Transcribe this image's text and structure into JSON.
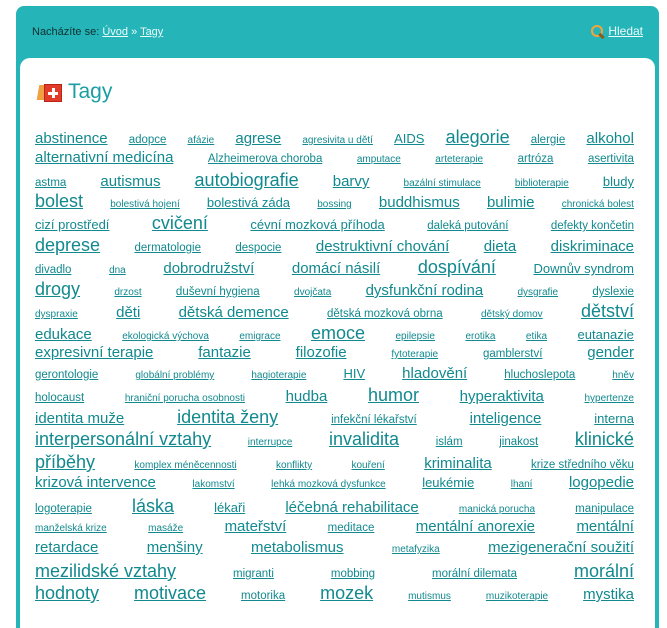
{
  "breadcrumb": {
    "prefix": "Nacházíte se:",
    "home": "Úvod",
    "separator": "»",
    "current": "Tagy"
  },
  "search": {
    "label": "Hledat",
    "icon": "magnifier-icon"
  },
  "page": {
    "title": "Tagy",
    "icon": "tag-icon"
  },
  "colors": {
    "frame": "#25b5b8",
    "link": "#12898e",
    "title": "#1a9ea3"
  },
  "lines": [
    [
      [
        "abstinence",
        4
      ],
      [
        "adopce",
        2
      ],
      [
        "afázie",
        1
      ],
      [
        "agrese",
        4
      ],
      [
        "agresivita u dětí",
        1
      ],
      [
        "AIDS",
        3
      ],
      [
        "alegorie",
        5
      ],
      [
        "alergie",
        2
      ],
      [
        "alkohol",
        4
      ]
    ],
    [
      [
        "alternativní medicína",
        4
      ],
      [
        "Alzheimerova choroba",
        2
      ],
      [
        "amputace",
        1
      ],
      [
        "arteterapie",
        1
      ],
      [
        "artróza",
        2
      ],
      [
        "asertivita",
        2
      ]
    ],
    [
      [
        "astma",
        2
      ],
      [
        "autismus",
        4
      ],
      [
        "autobiografie",
        5
      ],
      [
        "barvy",
        4
      ],
      [
        "bazální stimulace",
        1
      ],
      [
        "biblioterapie",
        1
      ],
      [
        "bludy",
        3
      ]
    ],
    [
      [
        "bolest",
        5
      ],
      [
        "bolestivá hojení",
        1
      ],
      [
        "bolestivá záda",
        3
      ],
      [
        "bossing",
        1
      ],
      [
        "buddhismus",
        4
      ],
      [
        "bulimie",
        4
      ],
      [
        "chronická bolest",
        1
      ]
    ],
    [
      [
        "cizí prostředí",
        3
      ],
      [
        "cvičení",
        5
      ],
      [
        "cévní mozková příhoda",
        3
      ],
      [
        "daleká putování",
        2
      ],
      [
        "defekty končetin",
        2
      ]
    ],
    [
      [
        "deprese",
        5
      ],
      [
        "dermatologie",
        2
      ],
      [
        "despocie",
        2
      ],
      [
        "destruktivní chování",
        4
      ],
      [
        "dieta",
        4
      ],
      [
        "diskriminace",
        4
      ]
    ],
    [
      [
        "divadlo",
        2
      ],
      [
        "dna",
        1
      ],
      [
        "dobrodružství",
        4
      ],
      [
        "domácí násilí",
        4
      ],
      [
        "dospívání",
        5
      ],
      [
        "Downův syndrom",
        3
      ]
    ],
    [
      [
        "drogy",
        5
      ],
      [
        "drzost",
        1
      ],
      [
        "duševní hygiena",
        2
      ],
      [
        "dvojčata",
        1
      ],
      [
        "dysfunkční rodina",
        4
      ],
      [
        "dysgrafie",
        1
      ],
      [
        "dyslexie",
        2
      ]
    ],
    [
      [
        "dyspraxie",
        1
      ],
      [
        "děti",
        4
      ],
      [
        "dětská demence",
        4
      ],
      [
        "dětská mozková obrna",
        2
      ],
      [
        "dětský domov",
        1
      ],
      [
        "dětství",
        5
      ]
    ],
    [
      [
        "edukace",
        4
      ],
      [
        "ekologická výchova",
        1
      ],
      [
        "emigrace",
        1
      ],
      [
        "emoce",
        5
      ],
      [
        "epilepsie",
        1
      ],
      [
        "erotika",
        1
      ],
      [
        "etika",
        1
      ],
      [
        "eutanazie",
        3
      ]
    ],
    [
      [
        "expresivní terapie",
        4
      ],
      [
        "fantazie",
        4
      ],
      [
        "filozofie",
        4
      ],
      [
        "fytoterapie",
        1
      ],
      [
        "gamblerství",
        2
      ],
      [
        "gender",
        4
      ]
    ],
    [
      [
        "gerontologie",
        2
      ],
      [
        "globální problémy",
        1
      ],
      [
        "hagioterapie",
        1
      ],
      [
        "HIV",
        3
      ],
      [
        "hladovění",
        4
      ],
      [
        "hluchoslepota",
        2
      ],
      [
        "hněv",
        1
      ]
    ],
    [
      [
        "holocaust",
        2
      ],
      [
        "hraniční porucha osobnosti",
        1
      ],
      [
        "hudba",
        4
      ],
      [
        "humor",
        5
      ],
      [
        "hyperaktivita",
        4
      ],
      [
        "hypertenze",
        1
      ]
    ],
    [
      [
        "identita muže",
        4
      ],
      [
        "identita ženy",
        5
      ],
      [
        "infekční lékařství",
        2
      ],
      [
        "inteligence",
        4
      ],
      [
        "interna",
        3
      ]
    ],
    [
      [
        "interpersonální vztahy",
        5
      ],
      [
        "interrupce",
        1
      ],
      [
        "invalidita",
        5
      ],
      [
        "islám",
        2
      ],
      [
        "jinakost",
        2
      ],
      [
        "klinické",
        5
      ]
    ],
    [
      [
        "příběhy",
        5
      ],
      [
        "komplex méněcennosti",
        1
      ],
      [
        "konflikty",
        1
      ],
      [
        "kouření",
        1
      ],
      [
        "kriminalita",
        4
      ],
      [
        "krize středního věku",
        2
      ]
    ],
    [
      [
        "krizová intervence",
        4
      ],
      [
        "lakomství",
        1
      ],
      [
        "lehká mozková dysfunkce",
        1
      ],
      [
        "leukémie",
        3
      ],
      [
        "lhaní",
        1
      ],
      [
        "logopedie",
        4
      ]
    ],
    [
      [
        "logoterapie",
        2
      ],
      [
        "láska",
        5
      ],
      [
        "lékaři",
        3
      ],
      [
        "léčebná rehabilitace",
        4
      ],
      [
        "manická porucha",
        1
      ],
      [
        "manipulace",
        2
      ]
    ],
    [
      [
        "manželská krize",
        1
      ],
      [
        "masáže",
        1
      ],
      [
        "mateřství",
        4
      ],
      [
        "meditace",
        2
      ],
      [
        "mentální anorexie",
        4
      ],
      [
        "mentální",
        4
      ]
    ],
    [
      [
        "retardace",
        4
      ],
      [
        "menšiny",
        4
      ],
      [
        "metabolismus",
        4
      ],
      [
        "metafyzika",
        1
      ],
      [
        "mezigenerační soužití",
        4
      ]
    ],
    [
      [
        "mezilidské vztahy",
        5
      ],
      [
        "migranti",
        2
      ],
      [
        "mobbing",
        2
      ],
      [
        "morální dilemata",
        2
      ],
      [
        "morální",
        5
      ]
    ],
    [
      [
        "hodnoty",
        5
      ],
      [
        "motivace",
        5
      ],
      [
        "motorika",
        2
      ],
      [
        "mozek",
        5
      ],
      [
        "mutismus",
        1
      ],
      [
        "muzikoterapie",
        1
      ],
      [
        "mystika",
        4
      ]
    ]
  ]
}
